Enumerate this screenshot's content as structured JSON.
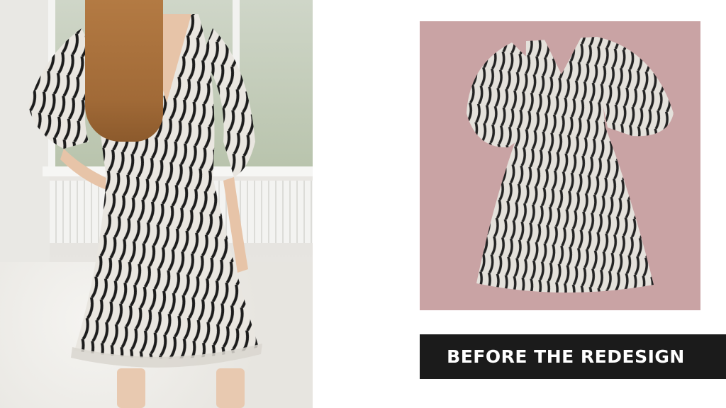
{
  "caption": {
    "text": "BEFORE THE REDESIGN"
  },
  "colors": {
    "caption_background": "#1b1b1b",
    "caption_text": "#ffffff",
    "right_photo_background": "#c9a3a4",
    "page_background": "#ffffff"
  },
  "images": {
    "left_photo": "woman-wearing-zebra-print-dress",
    "right_photo": "zebra-print-dress-flat-lay"
  }
}
